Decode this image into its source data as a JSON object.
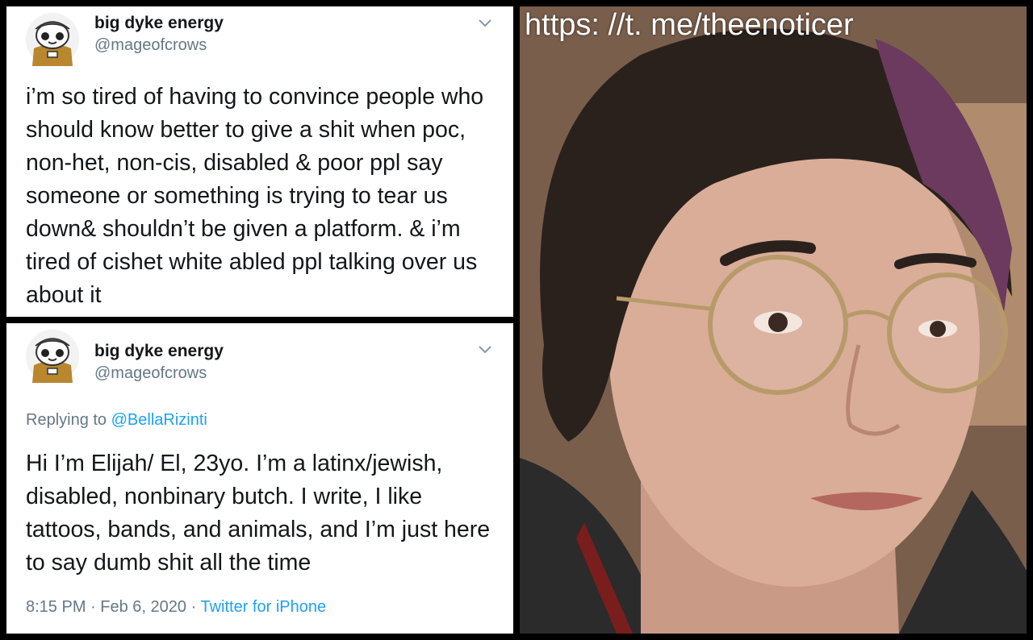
{
  "tweet1": {
    "display_name": "big dyke energy",
    "handle": "@mageofcrows",
    "text": "i’m so tired of having to convince people who should know better to give a shit when poc, non-het, non-cis, disabled & poor ppl say someone or something is trying to tear us down& shouldn’t be given a platform. & i’m tired of cishet white abled ppl talking over us about it",
    "menu_icon": "chevron-down-icon",
    "avatar_icon": "cartoon-avatar"
  },
  "tweet2": {
    "display_name": "big dyke energy",
    "handle": "@mageofcrows",
    "replying_to_label": "Replying to",
    "replying_to_user": "@BellaRizinti",
    "text": "Hi I’m Elijah/ El, 23yo. I’m a latinx/jewish, disabled, nonbinary butch. I write, I like tattoos, bands, and animals, and I’m just here to say dumb shit all the time",
    "time": "8:15 PM",
    "date": "Feb 6, 2020",
    "separator": "·",
    "source": "Twitter for iPhone",
    "menu_icon": "chevron-down-icon",
    "avatar_icon": "cartoon-avatar"
  },
  "photo": {
    "watermark": "https: //t. me/theenoticer",
    "subject": "selfie-photo"
  },
  "colors": {
    "text_primary": "#14171a",
    "text_secondary": "#657786",
    "link": "#1da1f2",
    "background": "#000000"
  }
}
